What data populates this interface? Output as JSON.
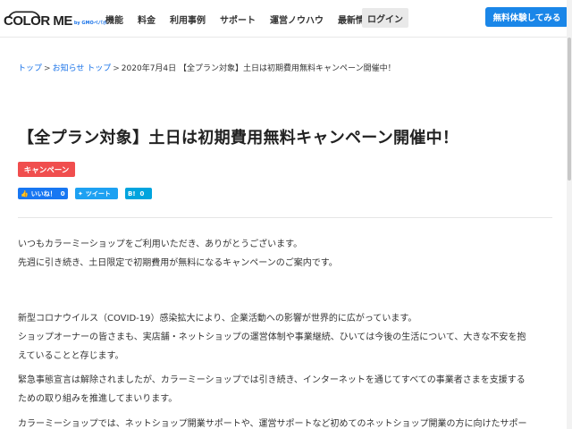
{
  "header": {
    "logo": "COLOR ME",
    "logo_sub": "by GMOペパボ",
    "nav": [
      "機能",
      "料金",
      "利用事例",
      "サポート",
      "運営ノウハウ",
      "最新情報"
    ],
    "login_label": "ログイン",
    "cta_label": "無料体験してみる"
  },
  "breadcrumb": {
    "items": [
      "トップ",
      "お知らせ トップ"
    ],
    "separator": ">",
    "current": "2020年7月4日 【全プラン対象】土日は初期費用無料キャンペーン開催中！"
  },
  "article": {
    "title": "【全プラン対象】土日は初期費用無料キャンペーン開催中！",
    "category": "キャンペーン",
    "share": {
      "facebook_label": "いいね！",
      "facebook_count": "0",
      "twitter_label": "ツイート",
      "hatena_label": "B!",
      "hatena_count": "0"
    },
    "paragraphs": [
      [
        "いつもカラーミーショップをご利用いただき、ありがとうございます。",
        "先週に引き続き、土日限定で初期費用が無料になるキャンペーンのご案内です。"
      ],
      [
        "新型コロナウイルス（COVID-19）感染拡大により、企業活動への影響が世界的に広がっています。",
        "ショップオーナーの皆さまも、実店舗・ネットショップの運営体制や事業継続、ひいては今後の生活について、大きな不安を抱",
        "えていることと存じます。"
      ],
      [
        "緊急事態宣言は解除されましたが、カラーミーショップでは引き続き、インターネットを通じてすべての事業者さまを支援する",
        "ための取り組みを推進してまいります。"
      ],
      [
        "カラーミーショップでは、ネットショップ開業サポートや、運営サポートなど初めてのネットショップ開業の方に向けたサポー"
      ]
    ]
  },
  "colors": {
    "accent": "#1a86e8",
    "badge": "#f04e4e",
    "link": "#1a73e8"
  }
}
